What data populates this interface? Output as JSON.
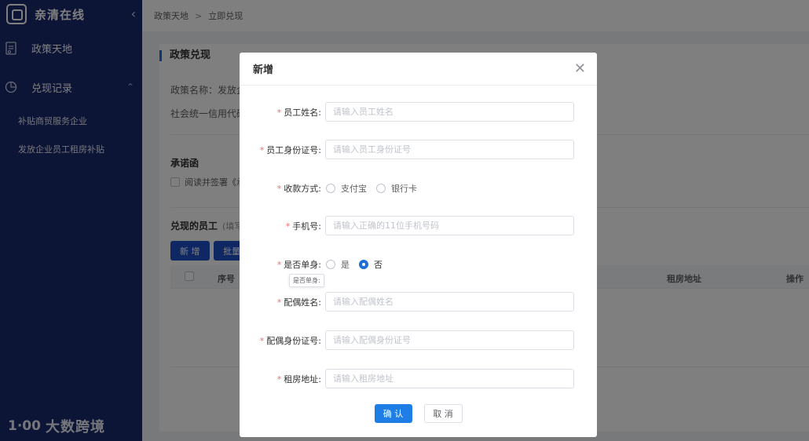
{
  "app": {
    "logo_text": "亲清在线",
    "brand_name": "大数跨境",
    "brand_logo": "1·00"
  },
  "sidebar": {
    "items": [
      {
        "label": "政策天地"
      },
      {
        "label": "兑现记录"
      }
    ],
    "sub_items": [
      {
        "label": "补贴商贸服务企业"
      },
      {
        "label": "发放企业员工租房补贴"
      }
    ]
  },
  "breadcrumb": {
    "parent": "政策天地",
    "separator": ">",
    "current": "立即兑现"
  },
  "page": {
    "title": "政策兑现",
    "policy_name_label": "政策名称：发放企",
    "credit_code_label": "社会统一信用代码",
    "pledge_title": "承诺函",
    "pledge_text": "阅读并签署《承",
    "employees_title": "兑现的员工",
    "employees_hint": "(填写",
    "add_button": "新 增",
    "batch_button": "批量",
    "table_headers": {
      "index": "序号",
      "address": "租房地址",
      "action": "操作"
    }
  },
  "dialog": {
    "title": "新增",
    "fields": {
      "name": {
        "label": "员工姓名:",
        "placeholder": "请输入员工姓名"
      },
      "id_number": {
        "label": "员工身份证号:",
        "placeholder": "请输入员工身份证号"
      },
      "payment": {
        "label": "收款方式:",
        "options": [
          "支付宝",
          "银行卡"
        ]
      },
      "phone": {
        "label": "手机号:",
        "placeholder": "请输入正确的11位手机号码"
      },
      "single": {
        "label": "是否单身:",
        "options": [
          "是",
          "否"
        ],
        "selected": "否",
        "tooltip": "是否单身:"
      },
      "spouse_name": {
        "label": "配偶姓名:",
        "placeholder": "请输入配偶姓名"
      },
      "spouse_id": {
        "label": "配偶身份证号:",
        "placeholder": "请输入配偶身份证号"
      },
      "address": {
        "label": "租房地址:",
        "placeholder": "请输入租房地址"
      }
    },
    "confirm_button": "确 认",
    "cancel_button": "取 消"
  },
  "colors": {
    "sidebar_bg": "#1a2b6d",
    "primary": "#1e7ee6",
    "required": "#f56c6c"
  }
}
